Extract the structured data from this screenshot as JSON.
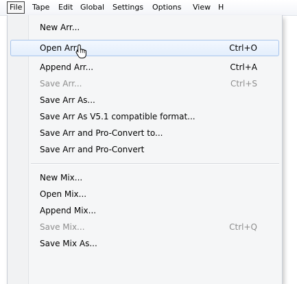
{
  "menubar": {
    "items": [
      {
        "label": "File"
      },
      {
        "label": "Tape"
      },
      {
        "label": "Edit"
      },
      {
        "label": "Global"
      },
      {
        "label": "Settings"
      },
      {
        "label": "Options"
      },
      {
        "label": "View"
      },
      {
        "label": "H"
      }
    ]
  },
  "file_menu": {
    "items": [
      {
        "label": "New Arr...",
        "shortcut": "",
        "state": "normal"
      },
      {
        "label": "Open Arr...",
        "shortcut": "Ctrl+O",
        "state": "hover"
      },
      {
        "label": "Append Arr...",
        "shortcut": "Ctrl+A",
        "state": "normal"
      },
      {
        "label": "Save Arr...",
        "shortcut": "Ctrl+S",
        "state": "disabled"
      },
      {
        "label": "Save Arr As...",
        "shortcut": "",
        "state": "normal"
      },
      {
        "label": "Save Arr As V5.1 compatible format...",
        "shortcut": "",
        "state": "normal"
      },
      {
        "label": "Save Arr and Pro-Convert to...",
        "shortcut": "",
        "state": "normal"
      },
      {
        "label": "Save Arr and Pro-Convert",
        "shortcut": "",
        "state": "normal"
      },
      {
        "label": "New Mix...",
        "shortcut": "",
        "state": "normal"
      },
      {
        "label": "Open Mix...",
        "shortcut": "",
        "state": "normal"
      },
      {
        "label": "Append Mix...",
        "shortcut": "",
        "state": "normal"
      },
      {
        "label": "Save Mix...",
        "shortcut": "Ctrl+Q",
        "state": "disabled"
      },
      {
        "label": "Save Mix As...",
        "shortcut": "",
        "state": "normal"
      }
    ]
  },
  "colors": {
    "hover_fill": "#e3eefc",
    "hover_border": "#a7c4ec",
    "disabled_text": "#8d8d8d"
  }
}
